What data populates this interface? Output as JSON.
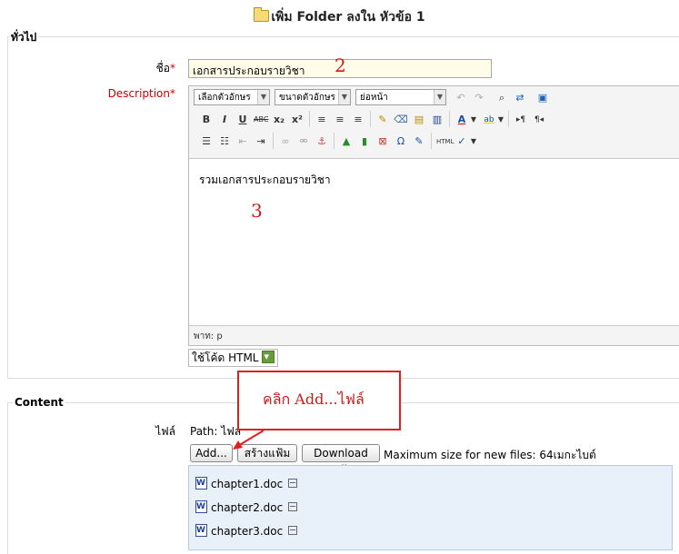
{
  "page": {
    "title": "เพิ่ม Folder ลงใน หัวข้อ 1"
  },
  "general": {
    "legend": "ทั่วไป",
    "name_label": "ชื่อ",
    "name_value": "เอกสารประกอบรายวิชา",
    "required_mark": "*",
    "description_label": "Description",
    "editor": {
      "style_select": "เลือกตัวอักษร",
      "size_select": "ขนาดตัวอักษร",
      "paragraph_select": "ย่อหน้า",
      "content": "รวมเอกสารประกอบรายวิชา",
      "path": "พาท: p"
    },
    "html_toggle": "ใช้โค้ด HTML"
  },
  "content": {
    "legend": "Content",
    "files_label": "ไฟล์",
    "path_text": "Path: ไฟล์",
    "add_button": "Add...",
    "create_folder_button": "สร้างแฟ้ม",
    "download_all_button": "Download all",
    "max_size_text": "Maximum size for new files: 64เมกะไบต์",
    "files": [
      "chapter1.doc",
      "chapter2.doc",
      "chapter3.doc"
    ]
  },
  "annotations": {
    "callout_text": "คลิก Add...ไฟล์",
    "step_2": "2",
    "step_3": "3"
  }
}
